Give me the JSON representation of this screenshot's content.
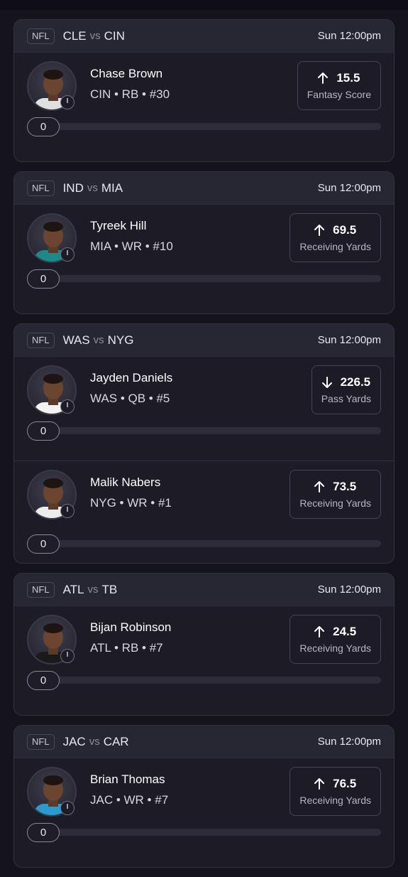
{
  "cards": [
    {
      "league": "NFL",
      "team_home": "CLE",
      "vs": "vs",
      "team_away": "CIN",
      "time": "Sun 12:00pm",
      "picks": [
        {
          "name": "Chase Brown",
          "meta": "CIN • RB • #30",
          "direction": "up",
          "value": "15.5",
          "stat": "Fantasy Score",
          "progress": "0",
          "jersey": "#e0e0e0"
        }
      ]
    },
    {
      "league": "NFL",
      "team_home": "IND",
      "vs": "vs",
      "team_away": "MIA",
      "time": "Sun 12:00pm",
      "picks": [
        {
          "name": "Tyreek Hill",
          "meta": "MIA • WR • #10",
          "direction": "up",
          "value": "69.5",
          "stat": "Receiving Yards",
          "progress": "0",
          "jersey": "#1d8a8a"
        }
      ]
    },
    {
      "league": "NFL",
      "team_home": "WAS",
      "vs": "vs",
      "team_away": "NYG",
      "time": "Sun 12:00pm",
      "picks": [
        {
          "name": "Jayden Daniels",
          "meta": "WAS • QB • #5",
          "direction": "down",
          "value": "226.5",
          "stat": "Pass Yards",
          "progress": "0",
          "jersey": "#f2f2f2"
        },
        {
          "name": "Malik Nabers",
          "meta": "NYG • WR • #1",
          "direction": "up",
          "value": "73.5",
          "stat": "Receiving Yards",
          "progress": "0",
          "jersey": "#ececec"
        }
      ]
    },
    {
      "league": "NFL",
      "team_home": "ATL",
      "vs": "vs",
      "team_away": "TB",
      "time": "Sun 12:00pm",
      "picks": [
        {
          "name": "Bijan Robinson",
          "meta": "ATL • RB • #7",
          "direction": "up",
          "value": "24.5",
          "stat": "Receiving Yards",
          "progress": "0",
          "jersey": "#1a1a1a"
        }
      ]
    },
    {
      "league": "NFL",
      "team_home": "JAC",
      "vs": "vs",
      "team_away": "CAR",
      "time": "Sun 12:00pm",
      "picks": [
        {
          "name": "Brian Thomas",
          "meta": "JAC • WR • #7",
          "direction": "up",
          "value": "76.5",
          "stat": "Receiving Yards",
          "progress": "0",
          "jersey": "#2a9bd0"
        }
      ]
    }
  ],
  "colors": {
    "background": "#15141d",
    "card": "#1c1b26",
    "header": "#272633",
    "border": "#33323e"
  },
  "icons": {
    "up": "arrow-up-icon",
    "down": "arrow-down-icon",
    "clock": "clock-icon"
  }
}
